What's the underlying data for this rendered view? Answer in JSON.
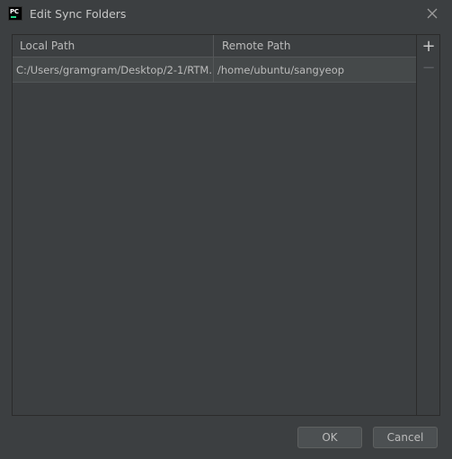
{
  "window": {
    "title": "Edit Sync Folders",
    "app_icon_text": "PC"
  },
  "table": {
    "columns": [
      "Local Path",
      "Remote Path"
    ],
    "rows": [
      {
        "local_path": "C:/Users/gramgram/Desktop/2-1/RTM...",
        "remote_path": "/home/ubuntu/sangyeop"
      }
    ]
  },
  "toolbar": {
    "add_symbol": "+",
    "remove_symbol": "−"
  },
  "buttons": {
    "ok_label": "OK",
    "cancel_label": "Cancel"
  },
  "colors": {
    "background": "#3c3f41",
    "selected_row": "#45494a",
    "text": "#bbbbbb"
  }
}
